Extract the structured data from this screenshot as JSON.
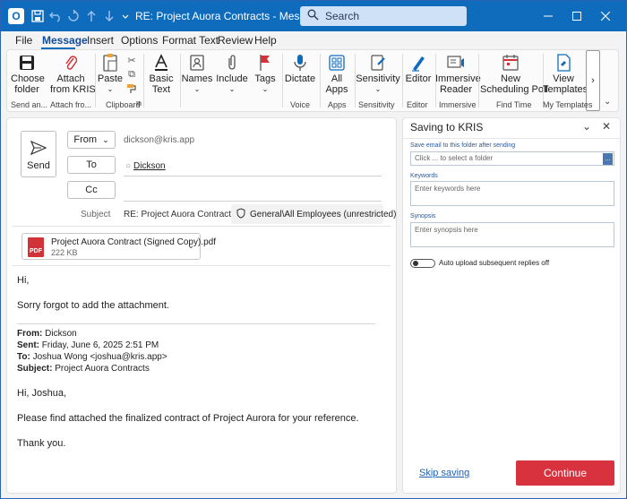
{
  "titlebar": {
    "title": "RE: Project Auora Contracts  -  Message (HT...",
    "search_placeholder": "Search"
  },
  "menu": [
    "File",
    "Message",
    "Insert",
    "Options",
    "Format Text",
    "Review",
    "Help"
  ],
  "ribbon": {
    "choose_folder": [
      "Choose",
      "folder"
    ],
    "attach_from_kris": [
      "Attach",
      "from KRIS"
    ],
    "paste": "Paste",
    "basic_text": [
      "Basic",
      "Text"
    ],
    "names": "Names",
    "include": "Include",
    "tags": "Tags",
    "dictate": "Dictate",
    "all_apps": [
      "All",
      "Apps"
    ],
    "sensitivity": "Sensitivity",
    "editor": "Editor",
    "immersive_reader": [
      "Immersive",
      "Reader"
    ],
    "new_scheduling_poll": [
      "New",
      "Scheduling Poll"
    ],
    "view_templates": [
      "View",
      "Templates"
    ],
    "groups": [
      "Send an...",
      "Attach fro...",
      "Clipboard",
      "Voice",
      "Apps",
      "Sensitivity",
      "Editor",
      "Immersive",
      "Find Time",
      "My Templates"
    ]
  },
  "compose": {
    "send_label": "Send",
    "from_label": "From",
    "from_value": "dickson@kris.app",
    "to_label": "To",
    "to_value": "Dickson",
    "cc_label": "Cc",
    "subject_label": "Subject",
    "subject_value": "RE: Project Auora Contracts",
    "sensitivity_label": "General\\All Employees (unrestricted)",
    "attachment_name": "Project Auora Contract (Signed Copy).pdf",
    "attachment_size": "222 KB",
    "attachment_badge": "PDF",
    "body": {
      "greeting": "Hi,",
      "line1": "Sorry forgot to add the attachment.",
      "quote_from_label": "From:",
      "quote_from": "Dickson",
      "quote_sent_label": "Sent:",
      "quote_sent": "Friday, June 6, 2025 2:51 PM",
      "quote_to_label": "To:",
      "quote_to": "Joshua Wong <joshua@kris.app>",
      "quote_subject_label": "Subject:",
      "quote_subject": "Project Auora Contracts",
      "q_greeting": "Hi, Joshua,",
      "q_line1": "Please find attached the finalized contract of Project Aurora for your reference.",
      "q_thanks": "Thank you."
    }
  },
  "pane": {
    "title": "Saving to KRIS",
    "folder_label": "Save email to this folder after sending",
    "folder_placeholder": "Click ... to select a folder",
    "browse": "...",
    "keywords_label": "Keywords",
    "keywords_placeholder": "Enter keywords here",
    "synopsis_label": "Synopsis",
    "synopsis_placeholder": "Enter synopsis here",
    "toggle_label": "Auto upload subsequent replies off",
    "skip_label": "Skip saving",
    "continue_label": "Continue"
  },
  "colors": {
    "titlebar": "#0f6cbd",
    "accent": "#0f6cbd",
    "continue": "#d9323f",
    "pdf": "#d13438"
  }
}
